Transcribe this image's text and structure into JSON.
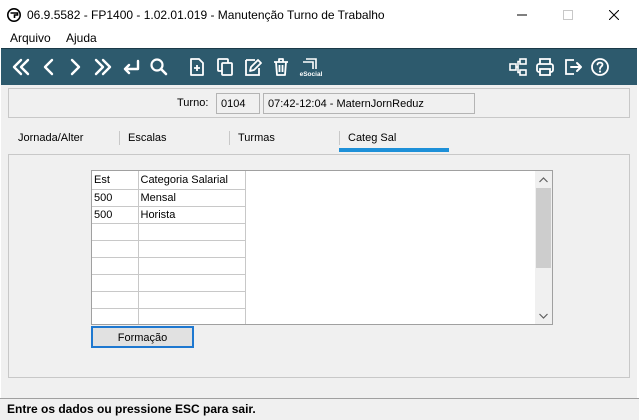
{
  "window": {
    "title": "06.9.5582 - FP1400 - 1.02.01.019 - Manutenção Turno de Trabalho",
    "app_icon": "fp-logo-icon",
    "controls": [
      "minimize-icon",
      "maximize-icon",
      "close-icon"
    ]
  },
  "menu": {
    "items": [
      {
        "label": "Arquivo"
      },
      {
        "label": "Ajuda"
      }
    ]
  },
  "toolbar": {
    "color": "#2d5a6d",
    "buttons_left": [
      "first-record-icon",
      "previous-record-icon",
      "next-record-icon",
      "last-record-icon",
      "return-icon",
      "search-icon",
      "new-document-icon",
      "copy-icon",
      "edit-icon",
      "delete-icon",
      "esocial-icon"
    ],
    "esocial_label": "eSocial",
    "buttons_right": [
      "hierarchy-icon",
      "print-icon",
      "exit-icon",
      "help-icon"
    ]
  },
  "turno": {
    "label": "Turno:",
    "code": "0104",
    "description": "07:42-12:04 - MaternJornReduz"
  },
  "tabs": [
    {
      "label": "Jornada/Alter"
    },
    {
      "label": "Escalas"
    },
    {
      "label": "Turmas"
    },
    {
      "label": "Categ Sal"
    }
  ],
  "active_tab": "Categ Sal",
  "accent_color": "#1e90d8",
  "grid": {
    "headers": [
      "Est",
      "Categoria Salarial"
    ],
    "rows": [
      [
        "500",
        "Mensal"
      ],
      [
        "500",
        "Horista"
      ],
      [
        "",
        ""
      ],
      [
        "",
        ""
      ],
      [
        "",
        ""
      ],
      [
        "",
        ""
      ],
      [
        "",
        ""
      ],
      [
        "",
        ""
      ]
    ]
  },
  "formacao_button": {
    "label": "Formação"
  },
  "status": {
    "text": "Entre os dados ou pressione ESC para sair."
  }
}
